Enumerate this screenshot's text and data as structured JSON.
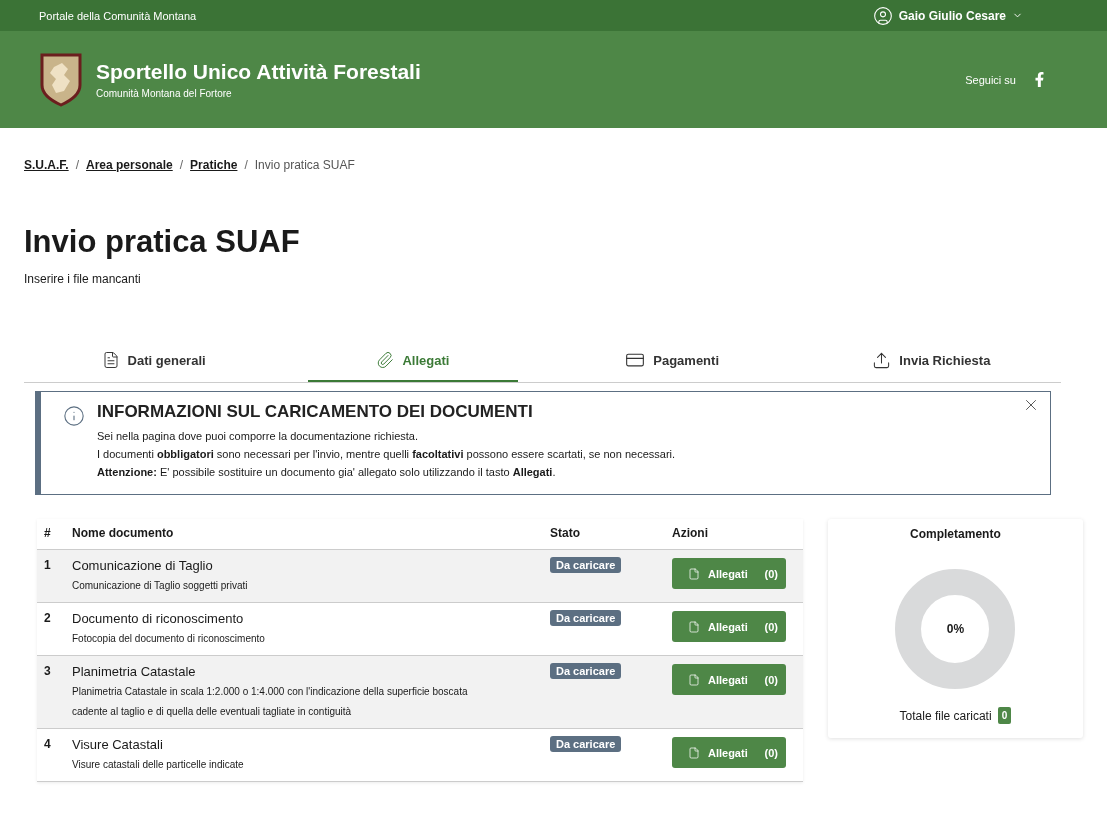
{
  "top_bar": {
    "portal": "Portale della Comunità Montana",
    "user": "Gaio Giulio Cesare"
  },
  "header": {
    "title": "Sportello Unico Attività Forestali",
    "subtitle": "Comunità Montana del Fortore",
    "social_label": "Seguici su"
  },
  "breadcrumb": {
    "separator": "/",
    "items": [
      {
        "label": "S.U.A.F.",
        "link": true
      },
      {
        "label": "Area personale",
        "link": true
      },
      {
        "label": "Pratiche",
        "link": true
      },
      {
        "label": "Invio pratica SUAF",
        "link": false
      }
    ]
  },
  "page": {
    "title": "Invio pratica SUAF",
    "subtitle": "Inserire i file mancanti"
  },
  "tabs": [
    {
      "label": "Dati generali",
      "kind": "file",
      "selected": false
    },
    {
      "label": "Allegati",
      "kind": "clip",
      "selected": true
    },
    {
      "label": "Pagamenti",
      "kind": "card",
      "selected": false
    },
    {
      "label": "Invia Richiesta",
      "kind": "upload",
      "selected": false
    }
  ],
  "alert": {
    "title": "INFORMAZIONI SUL CARICAMENTO DEI DOCUMENTI",
    "lines": [
      "Sei nella pagina dove puoi comporre la documentazione richiesta.",
      "I documenti **obbligatori** sono necessari per l'invio, mentre quelli **facoltativi** possono essere scartati, se non necessari.",
      "**Attenzione:** E' possibile sostituire un documento gia' allegato solo utilizzando il tasto **Allegati**."
    ]
  },
  "table": {
    "columns": [
      "#",
      "Nome documento",
      "Stato",
      "Azioni"
    ],
    "rows": [
      {
        "index": "1",
        "name": "Comunicazione di Taglio",
        "description": "Comunicazione di Taglio soggetti privati",
        "status": "Da caricare",
        "action": "Allegati",
        "count": "(0)"
      },
      {
        "index": "2",
        "name": "Documento di riconoscimento",
        "description": "Fotocopia del documento di riconoscimento",
        "status": "Da caricare",
        "action": "Allegati",
        "count": "(0)"
      },
      {
        "index": "3",
        "name": "Planimetria Catastale",
        "description": "Planimetria Catastale in scala 1:2.000 o 1:4.000 con l'indicazione della superficie boscata cadente al taglio e di quella delle eventuali tagliate in contiguità",
        "status": "Da caricare",
        "action": "Allegati",
        "count": "(0)"
      },
      {
        "index": "4",
        "name": "Visure Catastali",
        "description": "Visure catastali delle particelle indicate",
        "status": "Da caricare",
        "action": "Allegati",
        "count": "(0)"
      }
    ]
  },
  "completion": {
    "title": "Completamento",
    "percent": "0%",
    "total_label": "Totale file caricati",
    "total": "0"
  }
}
